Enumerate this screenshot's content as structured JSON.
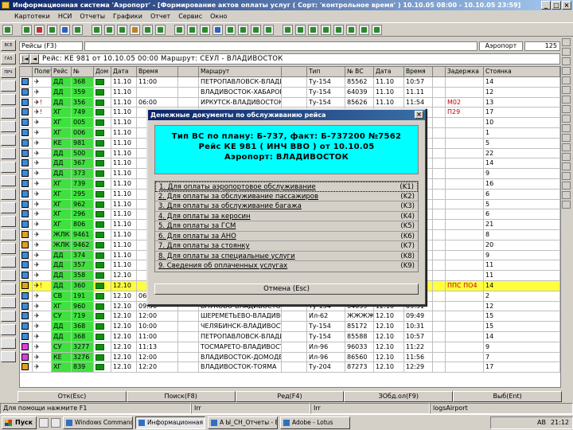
{
  "window": {
    "title": "Информационная система 'Аэропорт' - [Формирование актов оплаты услуг ( Сорт: 'контрольное время' ) 10.10.05 08:00 - 10.10.05 23:59]",
    "controls": [
      "_",
      "□",
      "×"
    ]
  },
  "menu": [
    "Картотеки",
    "НСИ",
    "Отчеты",
    "Графики",
    "Отчет",
    "Сервис",
    "Окно"
  ],
  "filter": {
    "label": "Рейсы (F3)",
    "time_label": "Аэропорт",
    "count": "125"
  },
  "flight_line": {
    "text": "Рейс: КЕ 981 от 10.10.05 00:00 Маршрут: СЕУЛ - ВЛАДИВОСТОК",
    "nav_left": "|◄",
    "nav_prev": "◄"
  },
  "left_buttons": [
    "ВСЕ",
    "ГАЗ",
    "ПРЧ",
    "",
    "",
    "",
    "",
    "",
    "",
    "",
    "",
    "",
    "",
    "",
    "",
    "",
    "",
    "",
    "",
    "",
    "",
    "",
    "",
    ""
  ],
  "grid": {
    "headers": [
      "",
      "Полет",
      "Рейс",
      "№",
      "Дом",
      "Дата",
      "Время",
      "",
      "Маршрут",
      "",
      "Тип",
      "№ ВС",
      "Дата",
      "Время",
      "",
      "Задержка",
      "Стоянка"
    ],
    "rows": [
      {
        "line": "ДД",
        "num": "368",
        "date": "11.10",
        "time": "11:00",
        "route": "ПЕТРОПАВЛОВСК-ВЛАДИВОСТОК",
        "ac": "Ту-154",
        "reg": "85562",
        "adate": "11.10",
        "atime": "10:57",
        "delay": "",
        "stand": "14",
        "rt": "b",
        "mark": ""
      },
      {
        "line": "ДД",
        "num": "359",
        "date": "11.10",
        "time": "",
        "route": "ВЛАДИВОСТОК-ХАБАРОВСК",
        "ac": "Ту-154",
        "reg": "64039",
        "adate": "11.10",
        "atime": "11.11",
        "delay": "",
        "stand": "12",
        "rt": "b",
        "mark": ""
      },
      {
        "line": "ДД",
        "num": "356",
        "date": "11.10",
        "time": "06:00",
        "route": "ИРКУТСК-ВЛАДИВОСТОК",
        "ac": "Ту-154",
        "reg": "85626",
        "adate": "11.10",
        "atime": "11:54",
        "delay": "М02",
        "stand": "13",
        "rt": "b",
        "mark": "!"
      },
      {
        "line": "ХГ",
        "num": "749",
        "date": "11.10",
        "time": "",
        "route": "ВЛАДИВОСТОК-МОСКВА",
        "ac": "Ту-154",
        "reg": "85100",
        "adate": "11.10",
        "atime": "12:08",
        "delay": "П29",
        "stand": "17",
        "rt": "b",
        "mark": "!"
      },
      {
        "line": "ХГ",
        "num": "005",
        "date": "11.10",
        "time": "",
        "route": "",
        "ac": "",
        "reg": "",
        "adate": "",
        "atime": "13:06",
        "delay": "",
        "stand": "10",
        "rt": "b",
        "mark": ""
      },
      {
        "line": "ХГ",
        "num": "006",
        "date": "11.10",
        "time": "",
        "route": "",
        "ac": "",
        "reg": "",
        "adate": "",
        "atime": "13:38",
        "delay": "",
        "stand": "1",
        "rt": "b",
        "mark": ""
      },
      {
        "line": "КЕ",
        "num": "981",
        "date": "11.10",
        "time": "",
        "route": "",
        "ac": "",
        "reg": "",
        "adate": "14.08",
        "atime": "",
        "delay": "",
        "stand": "5",
        "rt": "b",
        "mark": ""
      },
      {
        "line": "ДД",
        "num": "500",
        "date": "11.10",
        "time": "",
        "route": "",
        "ac": "",
        "reg": "",
        "adate": "14:14",
        "atime": "",
        "delay": "",
        "stand": "22",
        "rt": "b",
        "mark": ""
      },
      {
        "line": "ДД",
        "num": "367",
        "date": "11.10",
        "time": "",
        "route": "",
        "ac": "",
        "reg": "",
        "adate": "",
        "atime": "14:40",
        "delay": "",
        "stand": "14",
        "rt": "b",
        "mark": ""
      },
      {
        "line": "ДД",
        "num": "373",
        "date": "11.10",
        "time": "",
        "route": "",
        "ac": "",
        "reg": "",
        "adate": "",
        "atime": "15.15",
        "delay": "",
        "stand": "9",
        "rt": "b",
        "mark": ""
      },
      {
        "line": "ХГ",
        "num": "739",
        "date": "11.10",
        "time": "",
        "route": "",
        "ac": "",
        "reg": "",
        "adate": "15:30",
        "atime": "",
        "delay": "",
        "stand": "16",
        "rt": "b",
        "mark": ""
      },
      {
        "line": "ХГ",
        "num": "295",
        "date": "11.10",
        "time": "",
        "route": "",
        "ac": "",
        "reg": "",
        "adate": "16:09",
        "atime": "",
        "delay": "",
        "stand": "6",
        "rt": "b",
        "mark": ""
      },
      {
        "line": "ХГ",
        "num": "962",
        "date": "11.10",
        "time": "",
        "route": "",
        "ac": "",
        "reg": "",
        "adate": "",
        "atime": "16:26",
        "delay": "",
        "stand": "5",
        "rt": "b",
        "mark": ""
      },
      {
        "line": "ХГ",
        "num": "296",
        "date": "11.10",
        "time": "",
        "route": "",
        "ac": "",
        "reg": "",
        "adate": "",
        "atime": "17:50",
        "delay": "",
        "stand": "6",
        "rt": "b",
        "mark": ""
      },
      {
        "line": "ХГ",
        "num": "806",
        "date": "11.10",
        "time": "",
        "route": "",
        "ac": "",
        "reg": "",
        "adate": "18:07",
        "atime": "",
        "delay": "",
        "stand": "21",
        "rt": "b",
        "mark": ""
      },
      {
        "line": "ЖЛК",
        "num": "9461",
        "date": "11.10",
        "time": "",
        "route": "",
        "ac": "",
        "reg": "",
        "adate": "",
        "atime": "",
        "delay": "",
        "stand": "8",
        "rt": "o",
        "mark": ""
      },
      {
        "line": "ЖЛК",
        "num": "9462",
        "date": "11.10",
        "time": "",
        "route": "",
        "ac": "",
        "reg": "",
        "adate": "19:45",
        "atime": "",
        "delay": "",
        "stand": "20",
        "rt": "o",
        "mark": ""
      },
      {
        "line": "ДД",
        "num": "374",
        "date": "11.10",
        "time": "",
        "route": "",
        "ac": "",
        "reg": "",
        "adate": "20:17",
        "atime": "",
        "delay": "",
        "stand": "9",
        "rt": "b",
        "mark": ""
      },
      {
        "line": "ДД",
        "num": "357",
        "date": "11.10",
        "time": "",
        "route": "",
        "ac": "",
        "reg": "",
        "adate": "",
        "atime": "20:30",
        "delay": "",
        "stand": "11",
        "rt": "b",
        "mark": ""
      },
      {
        "line": "ДД",
        "num": "358",
        "date": "12.10",
        "time": "",
        "route": "",
        "ac": "",
        "reg": "",
        "adate": "07:40",
        "atime": "",
        "delay": "",
        "stand": "11",
        "rt": "b",
        "mark": ""
      },
      {
        "line": "ДД",
        "num": "360",
        "date": "12.10",
        "time": "",
        "route": "",
        "ac": "",
        "reg": "",
        "adate": "08.21",
        "atime": "",
        "delay": "ППС ПО4",
        "stand": "14",
        "rt": "o",
        "mark": "!",
        "sel": true
      },
      {
        "line": "СВ",
        "num": "191",
        "date": "12.10",
        "time": "06:00",
        "route": "ИРКУТСК-ВЛАДИВОСТОК",
        "ac": "Ту-154",
        "reg": "85100",
        "adate": "12.10",
        "atime": "09.06",
        "delay": "",
        "stand": "2",
        "rt": "b",
        "mark": ""
      },
      {
        "line": "ХГ",
        "num": "960",
        "date": "12.10",
        "time": "09:50",
        "route": "ВНУКОВО-ВЛАДИВОСТОК",
        "ac": "Ту-154",
        "reg": "64039",
        "adate": "12.10",
        "atime": "09:31",
        "delay": "",
        "stand": "12",
        "rt": "b",
        "mark": ""
      },
      {
        "line": "СУ",
        "num": "719",
        "date": "12.10",
        "time": "12:00",
        "route": "ШЕРЕМЕТЬЕВО-ВЛАДИВОСТОК",
        "ac": "Ил-62",
        "reg": "ЖЖЖЖЖ",
        "adate": "12.10",
        "atime": "09:49",
        "delay": "",
        "stand": "15",
        "rt": "b",
        "mark": ""
      },
      {
        "line": "ДД",
        "num": "368",
        "date": "12.10",
        "time": "10:00",
        "route": "ЧЕЛЯБИНСК-ВЛАДИВОСТОК",
        "ac": "Ту-154",
        "reg": "85172",
        "adate": "12.10",
        "atime": "10:31",
        "delay": "",
        "stand": "15",
        "rt": "b",
        "mark": ""
      },
      {
        "line": "ДД",
        "num": "368",
        "date": "12.10",
        "time": "11:00",
        "route": "ПЕТРОПАВЛОВСК-ВЛАДИВОСТОК",
        "ac": "Ту-154",
        "reg": "85588",
        "adate": "12.10",
        "atime": "10:57",
        "delay": "",
        "stand": "14",
        "rt": "b",
        "mark": ""
      },
      {
        "line": "СУ",
        "num": "3277",
        "date": "12.10",
        "time": "11:13",
        "route": "ТОСМАРЕТО-ВЛАДИВОСТОК-ПЕТРОПАВЛОВСК-КАМЧАТСКИЙ",
        "ac": "Ил-96",
        "reg": "96033",
        "adate": "12.10",
        "atime": "11:22",
        "delay": "",
        "stand": "9",
        "rt": "m",
        "mark": ""
      },
      {
        "line": "КЕ",
        "num": "3276",
        "date": "12.10",
        "time": "12:00",
        "route": "ВЛАДИВОСТОК-ДОМОДЕДОВО",
        "ac": "Ил-96",
        "reg": "86560",
        "adate": "12.10",
        "atime": "11:56",
        "delay": "",
        "stand": "7",
        "rt": "m",
        "mark": ""
      },
      {
        "line": "ХГ",
        "num": "839",
        "date": "12.10",
        "time": "12:20",
        "route": "ВЛАДИВОСТОК-ТОЯМА",
        "ac": "Ту-204",
        "reg": "87273",
        "adate": "12.10",
        "atime": "12:29",
        "delay": "",
        "stand": "17",
        "rt": "o",
        "mark": ""
      }
    ]
  },
  "status_buttons": [
    "Отк(Esc)",
    "Поиск(F8)",
    "Ред(F4)",
    "ЗОбд.ол(F9)",
    "Выб(Ent)"
  ],
  "hints": [
    "Для помощи нажмите F1",
    "Irr",
    "Irr",
    "logsAirport"
  ],
  "taskbar": {
    "start": "Пуск",
    "tasks": [
      "Windows Commander 5...",
      "Информационная с...",
      "A Ы_CH_Отчеты - Expl...",
      "Adobe - Lotus"
    ],
    "tray": {
      "lang": "AB",
      "time": "21:12"
    }
  },
  "dialog": {
    "title": "Денежные документы по обслуживанию рейса",
    "close": "×",
    "info": [
      "Тип ВС по плану: Б-737, факт: Б-737200 №7562",
      "Рейс КЕ 981 ( ИНЧ ВВО ) от 10.10.05",
      "Аэропорт: ВЛАДИВОСТОК"
    ],
    "options": [
      {
        "label": "1. Для оплаты аэропортовое обслуживание",
        "key": "(K1)"
      },
      {
        "label": "2. Для оплаты за обслуживание пассажиров",
        "key": "(K2)"
      },
      {
        "label": "3. Для оплаты за обслуживание багажа",
        "key": "(K3)"
      },
      {
        "label": "4. Для оплаты за керосин",
        "key": "(K4)"
      },
      {
        "label": "5. Для оплаты за ГСМ",
        "key": "(K5)"
      },
      {
        "label": "6. Для оплаты за АНО",
        "key": "(K6)"
      },
      {
        "label": "7. Для оплаты за стоянку",
        "key": "(K7)"
      },
      {
        "label": "8. Для оплаты за специальные услуги",
        "key": "(K8)"
      },
      {
        "label": "9. Сведения об оплаченных услугах",
        "key": "(K9)"
      }
    ],
    "cancel": "Отмена (Esc)"
  },
  "colors": {
    "title_bar": "#0a246a",
    "flight_green": "#40e040",
    "dialog_info": "#00ffff",
    "selected_row": "#ffff40"
  }
}
